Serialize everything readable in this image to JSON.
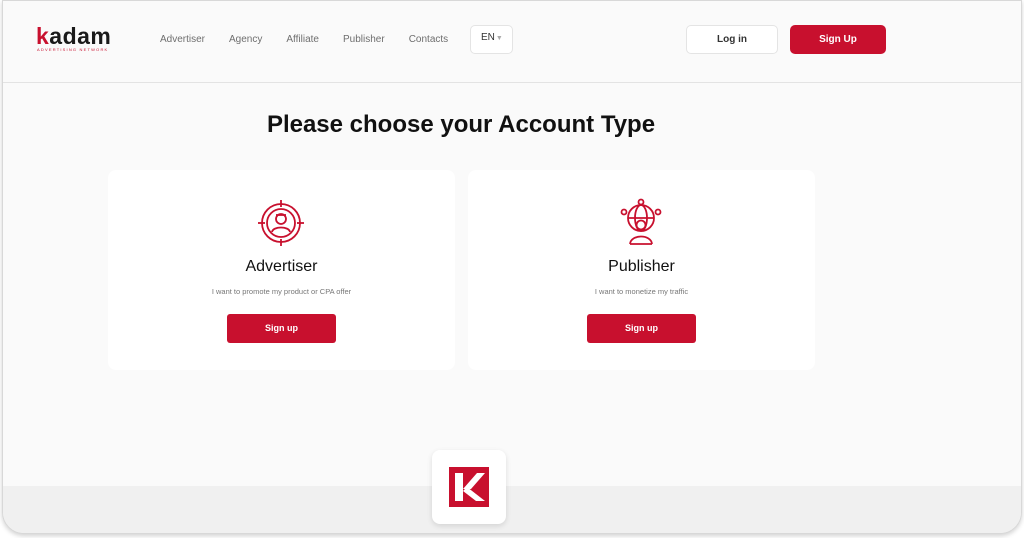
{
  "brand": {
    "logo_k": "k",
    "logo_rest": "adam",
    "logo_tagline": "ADVERTISING NETWORK",
    "accent_color": "#c8102e"
  },
  "nav": {
    "items": [
      {
        "label": "Advertiser"
      },
      {
        "label": "Agency"
      },
      {
        "label": "Affiliate"
      },
      {
        "label": "Publisher"
      },
      {
        "label": "Contacts"
      }
    ]
  },
  "header": {
    "language": "EN",
    "login_label": "Log in",
    "signup_label": "Sign Up"
  },
  "main": {
    "title": "Please choose your Account Type",
    "cards": [
      {
        "icon": "target-person-icon",
        "title": "Advertiser",
        "description": "I want to promote my product or CPA offer",
        "button": "Sign up"
      },
      {
        "icon": "globe-network-person-icon",
        "title": "Publisher",
        "description": "I want to monetize my traffic",
        "button": "Sign up"
      }
    ]
  },
  "footer": {
    "badge_icon": "kadam-k-logo-icon"
  }
}
